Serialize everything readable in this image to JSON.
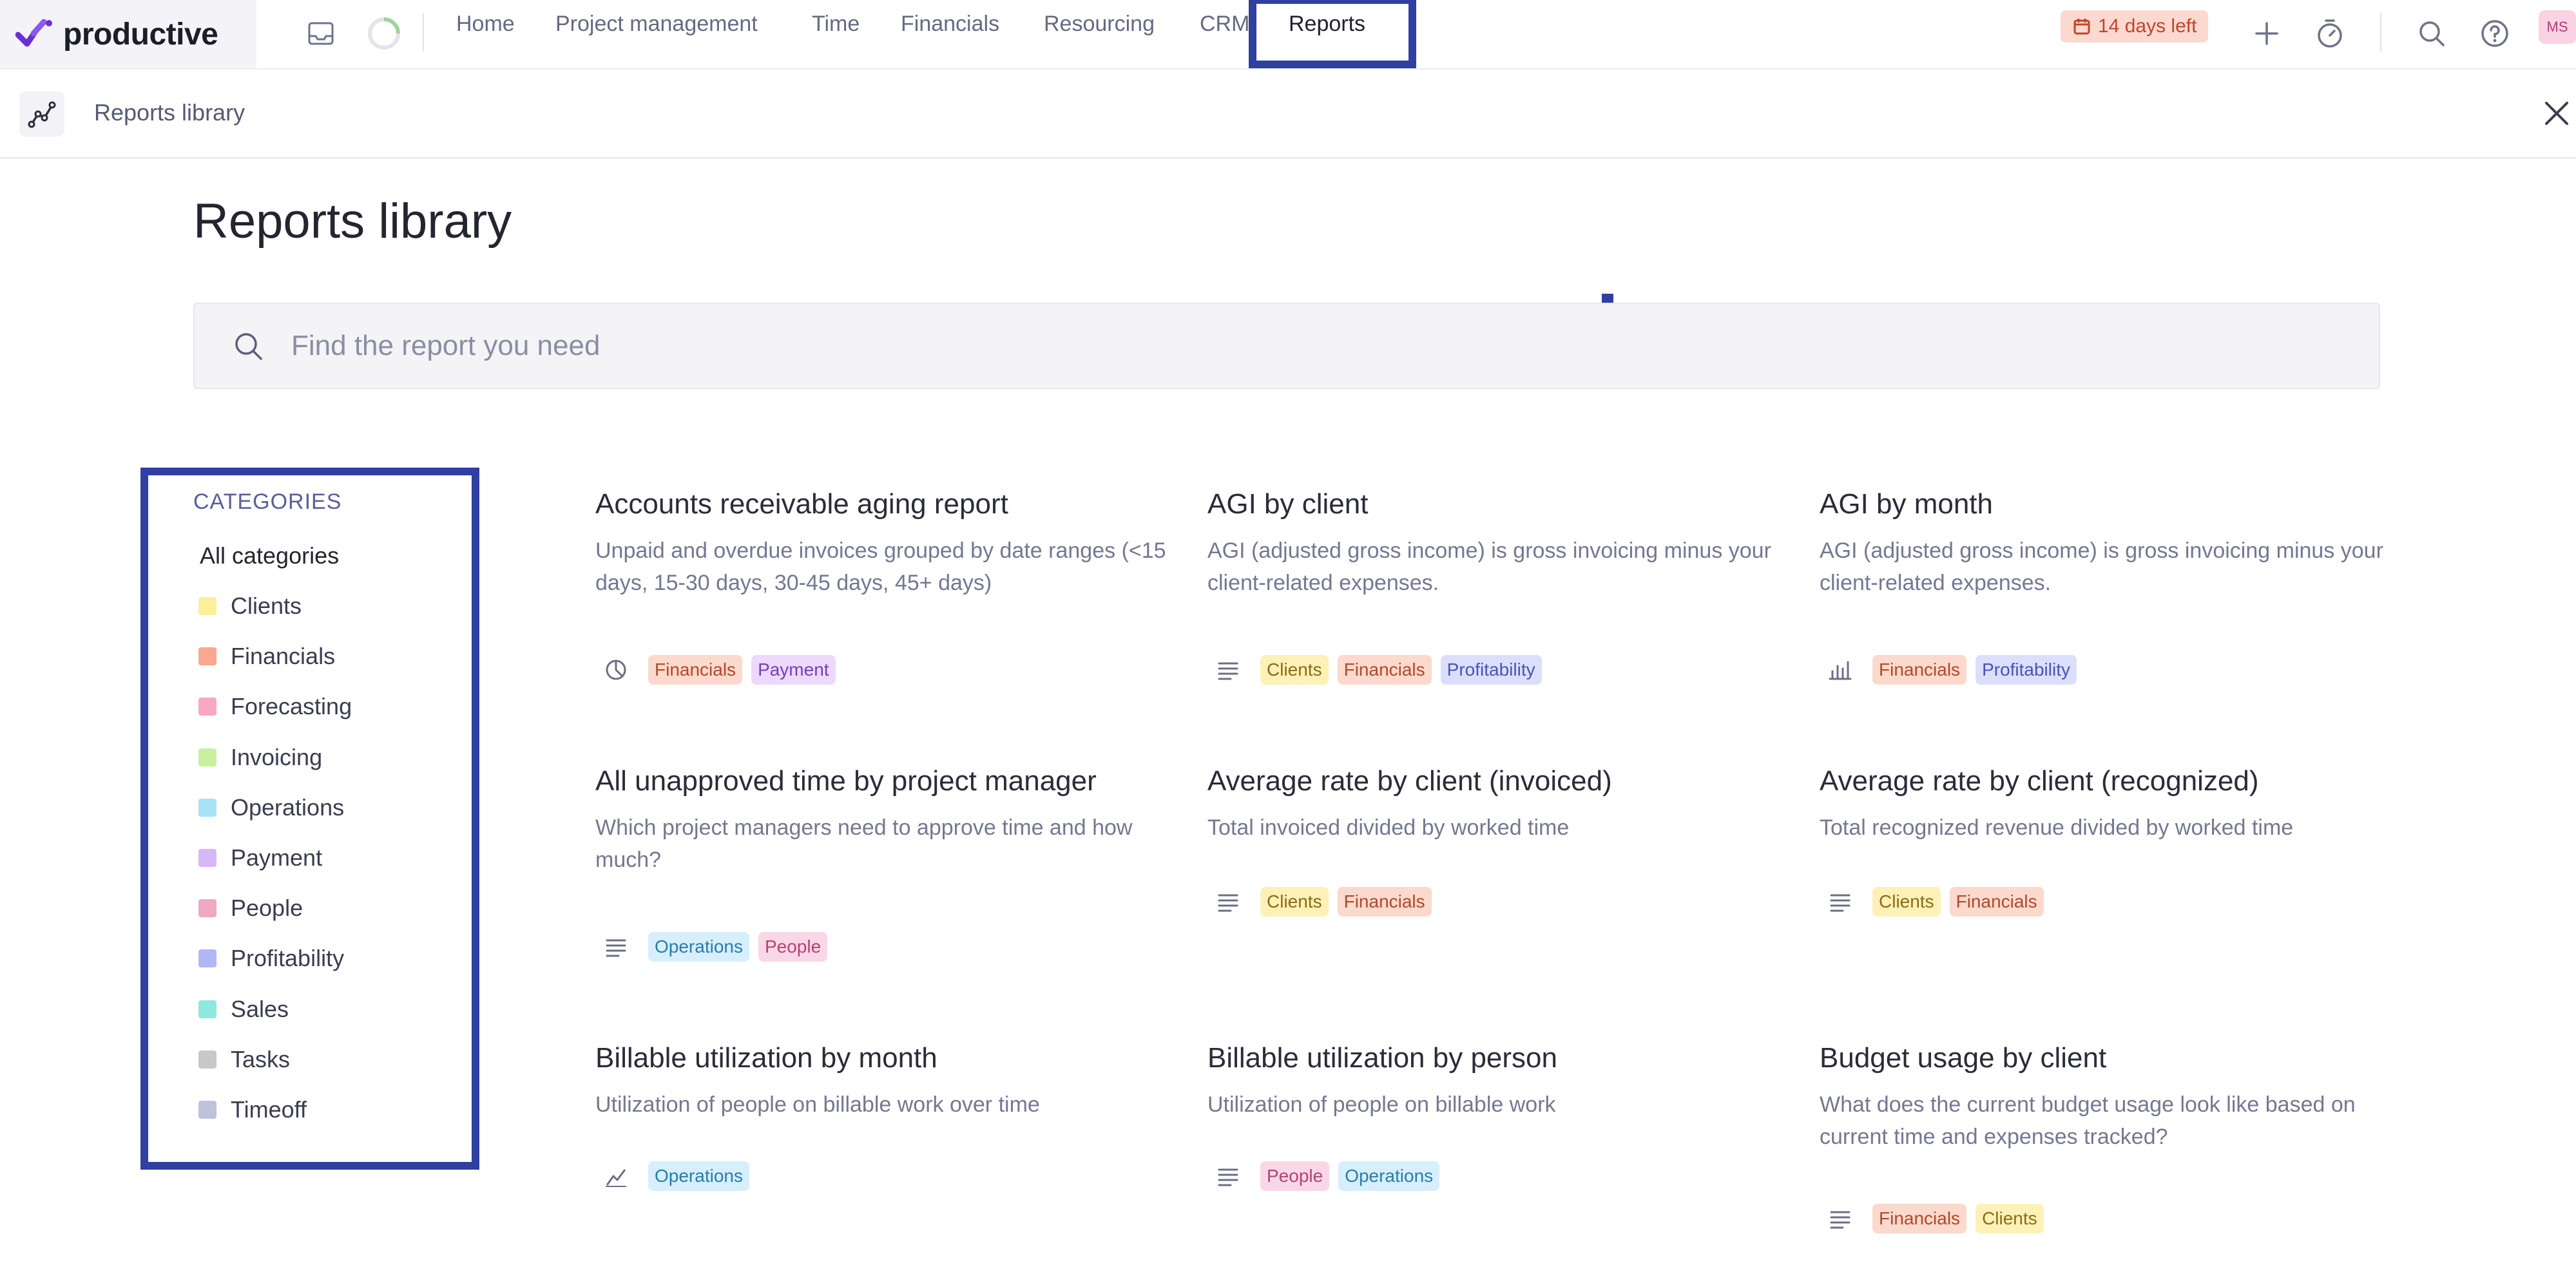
{
  "app": {
    "name": "productive"
  },
  "nav": {
    "items": [
      {
        "label": "Home"
      },
      {
        "label": "Project management"
      },
      {
        "label": "Time"
      },
      {
        "label": "Financials"
      },
      {
        "label": "Resourcing"
      },
      {
        "label": "CRM"
      },
      {
        "label": "Reports"
      }
    ],
    "active": "Reports"
  },
  "trial": {
    "label": "14 days left"
  },
  "user": {
    "initials": "MS"
  },
  "subbar": {
    "title": "Reports library"
  },
  "page": {
    "title": "Reports library"
  },
  "search": {
    "placeholder": "Find the report you need"
  },
  "categories": {
    "heading": "CATEGORIES",
    "all_label": "All categories",
    "items": [
      {
        "label": "Clients",
        "color": "#fdef9a"
      },
      {
        "label": "Financials",
        "color": "#f9a88e"
      },
      {
        "label": "Forecasting",
        "color": "#f9a8c4"
      },
      {
        "label": "Invoicing",
        "color": "#c9f0a0"
      },
      {
        "label": "Operations",
        "color": "#a8e2f6"
      },
      {
        "label": "Payment",
        "color": "#d6b8f6"
      },
      {
        "label": "People",
        "color": "#f0a8c4"
      },
      {
        "label": "Profitability",
        "color": "#b0b6f6"
      },
      {
        "label": "Sales",
        "color": "#8ee8de"
      },
      {
        "label": "Tasks",
        "color": "#c8c8c8"
      },
      {
        "label": "Timeoff",
        "color": "#c0c2dc"
      }
    ]
  },
  "reports": [
    {
      "title": "Accounts receivable aging report",
      "description": "Unpaid and overdue invoices grouped by date ranges (<15 days, 15-30 days, 30-45 days, 45+ days)",
      "icon": "pie-chart-icon",
      "tags": [
        "Financials",
        "Payment"
      ]
    },
    {
      "title": "AGI by client",
      "description": "AGI (adjusted gross income) is gross invoicing minus your client-related expenses.",
      "icon": "table-icon",
      "tags": [
        "Clients",
        "Financials",
        "Profitability"
      ]
    },
    {
      "title": "AGI by month",
      "description": "AGI (adjusted gross income) is gross invoicing minus your client-related expenses.",
      "icon": "bar-chart-icon",
      "tags": [
        "Financials",
        "Profitability"
      ]
    },
    {
      "title": "All unapproved time by project manager",
      "description": "Which project managers need to approve time and how much?",
      "icon": "table-icon",
      "tags": [
        "Operations",
        "People"
      ]
    },
    {
      "title": "Average rate by client (invoiced)",
      "description": "Total invoiced divided by worked time",
      "icon": "table-icon",
      "tags": [
        "Clients",
        "Financials"
      ]
    },
    {
      "title": "Average rate by client (recognized)",
      "description": "Total recognized revenue divided by worked time",
      "icon": "table-icon",
      "tags": [
        "Clients",
        "Financials"
      ]
    },
    {
      "title": "Billable utilization by month",
      "description": "Utilization of people on billable work over time",
      "icon": "line-chart-icon",
      "tags": [
        "Operations"
      ]
    },
    {
      "title": "Billable utilization by person",
      "description": "Utilization of people on billable work",
      "icon": "table-icon",
      "tags": [
        "People",
        "Operations"
      ]
    },
    {
      "title": "Budget usage by client",
      "description": "What does the current budget usage look like based on current time and expenses tracked?",
      "icon": "table-icon",
      "tags": [
        "Financials",
        "Clients"
      ]
    }
  ]
}
